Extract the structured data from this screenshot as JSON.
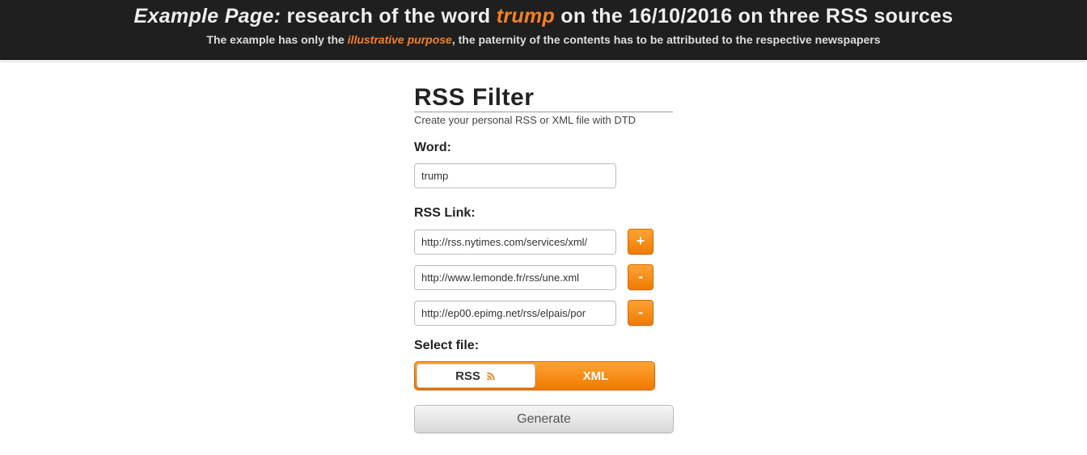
{
  "banner": {
    "prefix": "Example Page:",
    "mid1": " research of the word ",
    "highlight": "trump",
    "mid2": " on the 16/10/2016 on three RSS sources",
    "sub_pre": "The example has only the ",
    "sub_em": "illustrative purpose",
    "sub_post": ", the paternity of the contents has to be attributed to the respective newspapers"
  },
  "form": {
    "title": "RSS Filter",
    "subtitle": "Create your personal RSS or XML file with DTD",
    "word_label": "Word:",
    "word_value": "trump",
    "rss_label": "RSS Link:",
    "links": [
      {
        "value": "http://rss.nytimes.com/services/xml/",
        "btn": "+"
      },
      {
        "value": "http://www.lemonde.fr/rss/une.xml",
        "btn": "-"
      },
      {
        "value": "http://ep00.epimg.net/rss/elpais/por",
        "btn": "-"
      }
    ],
    "select_label": "Select file:",
    "seg_rss": "RSS",
    "seg_xml": "XML",
    "generate": "Generate"
  }
}
